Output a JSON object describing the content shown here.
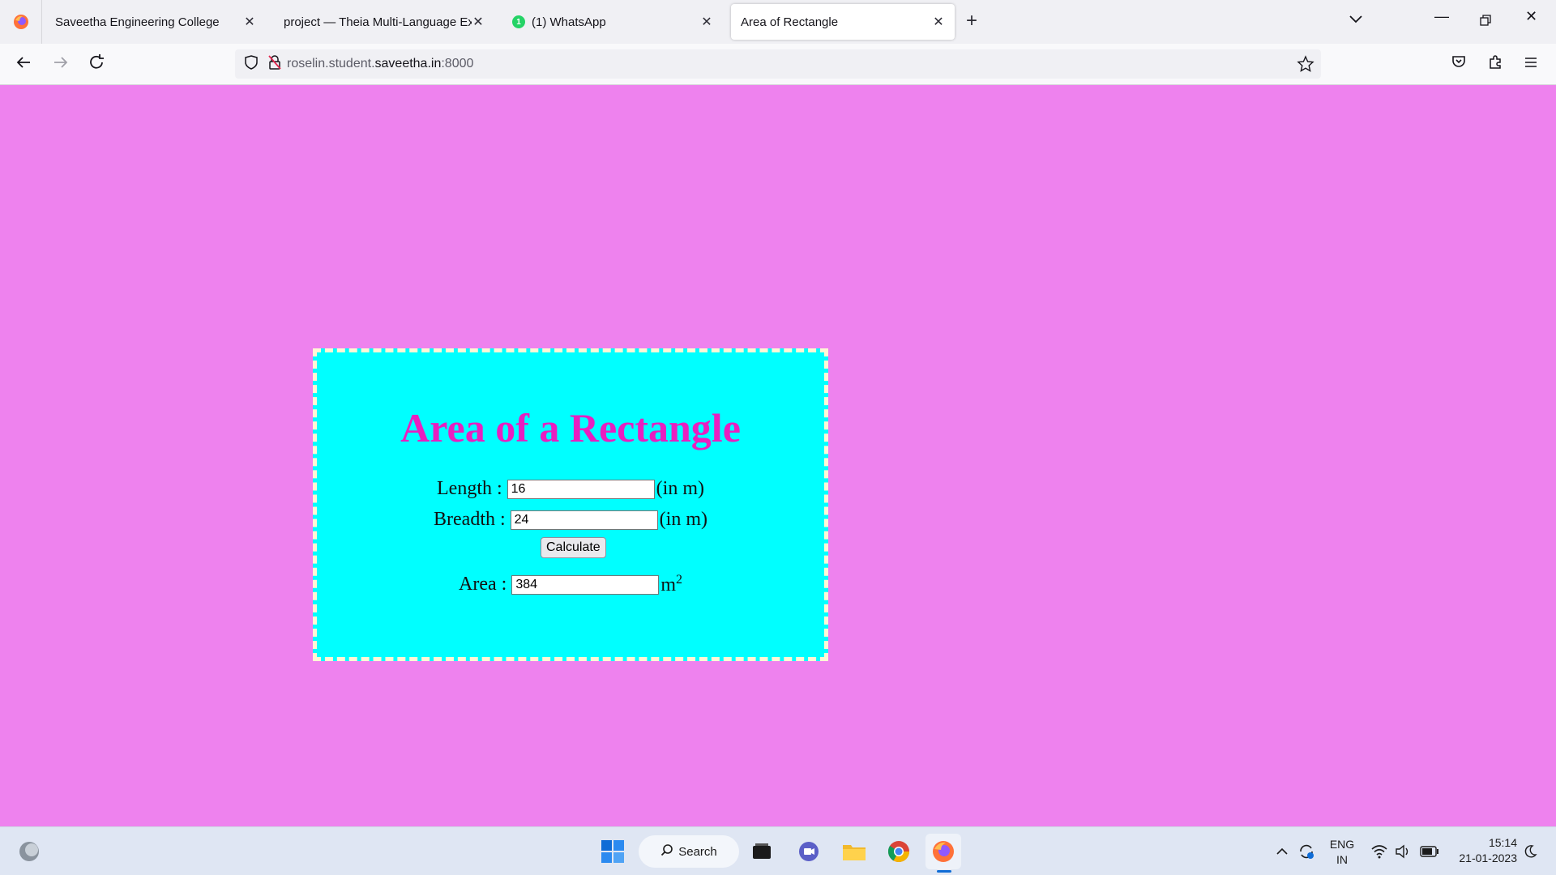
{
  "browser": {
    "tabs": [
      {
        "title": "Saveetha Engineering College",
        "active": false
      },
      {
        "title": "project — Theia Multi-Language Ex",
        "active": false
      },
      {
        "title": "(1) WhatsApp",
        "badge": "1",
        "active": false
      },
      {
        "title": "Area of Rectangle",
        "active": true
      }
    ],
    "url_prefix": "roselin.student.",
    "url_host": "saveetha.in",
    "url_port": ":8000"
  },
  "page": {
    "heading": "Area of a Rectangle",
    "length_label": "Length :",
    "length_value": "16",
    "length_unit": "(in m)",
    "breadth_label": "Breadth :",
    "breadth_value": "24",
    "breadth_unit": "(in m)",
    "calculate_label": "Calculate",
    "area_label": "Area :",
    "area_value": "384",
    "area_unit": "m",
    "area_unit_exp": "2",
    "colors": {
      "background": "#ee82ee",
      "card": "#00ffff",
      "heading": "#e81fc0",
      "card_border": "#fff7d6"
    }
  },
  "taskbar": {
    "search_label": "Search",
    "language_line1": "ENG",
    "language_line2": "IN",
    "time": "15:14",
    "date": "21-01-2023"
  }
}
